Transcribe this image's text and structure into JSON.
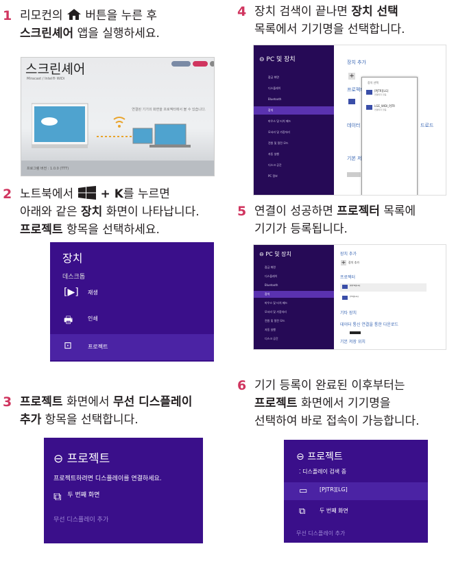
{
  "steps": [
    {
      "num": "1",
      "pre": "리모컨의 ",
      "post": " 버튼을 누른 후",
      "line2_bold": "스크린셰어",
      "line2_rest": " 앱을 실행하세요."
    },
    {
      "num": "2",
      "line1_pre": "노트북에서 ",
      "line1_bold": " + K",
      "line1_post": "를 누르면",
      "line2": "아래와 같은 ",
      "line2_bold": "장치",
      "line2_post": " 화면이 나타납니다.",
      "line3_bold": "프로젝트",
      "line3_post": " 항목을 선택하세요."
    },
    {
      "num": "3",
      "line1_bold": "프로젝트",
      "line1_mid": " 화면에서 ",
      "line1_bold2": "무선 디스플레이",
      "line2_bold": "추가",
      "line2_post": " 항목을 선택합니다."
    },
    {
      "num": "4",
      "line1_pre": "장치 검색이 끝나면 ",
      "line1_bold": "장치 선택",
      "line2": "목록에서 기기명을 선택합니다."
    },
    {
      "num": "5",
      "line1_pre": "연결이 성공하면 ",
      "line1_bold": "프로젝터",
      "line1_post": " 목록에",
      "line2": "기기가 등록됩니다."
    },
    {
      "num": "6",
      "line1": "기기 등록이 완료된 이후부터는",
      "line2_bold": "프로젝트",
      "line2_post": " 화면에서 기기명을",
      "line3": "선택하여 바로 접속이 가능합니다."
    }
  ],
  "screen1": {
    "title": "스크린셰어",
    "subtitle": "Miracast / Intel® WiDi",
    "message": "연결된 기기의 화면을 프로젝터에서 볼 수 있습니다.",
    "version": "프로그램 버전 : 1.0.0 (TTT)"
  },
  "devices_panel": {
    "title": "장치",
    "section": "데스크톱",
    "items": [
      {
        "icon": "[▶]",
        "label": "재생"
      },
      {
        "icon": "🖶",
        "label": "인쇄"
      },
      {
        "icon": "⊡",
        "label": "프로젝트"
      }
    ]
  },
  "project_panel": {
    "title": "프로젝트",
    "instruction": "프로젝트하려면 디스플레이를 연결하세요.",
    "second_screen": "두 번째 화면",
    "add_wireless": "무선 디스플레이 추가"
  },
  "pc_settings": {
    "title": "PC 및 장치",
    "menu": [
      "잠금 화면",
      "디스플레이",
      "Bluetooth",
      "장치",
      "마우스 및 터치 패드",
      "모서리 및 가장자리",
      "전원 및 절전 모드",
      "자동 실행",
      "디스크 공간",
      "PC 정보"
    ],
    "selected": "장치",
    "add_device": "장치 추가",
    "projector": "프로젝터",
    "data": "데이터",
    "data_tail": "드로드",
    "basic": "기본 저",
    "popup_title": "장치 선택",
    "devices": [
      {
        "name": "[PJTR][LG]",
        "status": "연결되지 않음"
      },
      {
        "name": "LGE_WIDI_PJTR",
        "status": "연결되지 않음"
      }
    ]
  },
  "pc_settings5": {
    "title": "PC 및 장치",
    "add_device": "장치 추가",
    "add_device_btn": "장치 추가",
    "projector": "프로젝터",
    "other_devices": "기타 장치",
    "data_download": "데이터 통신 연결을 통한 다운로드",
    "basic_save": "기본 저장 위치",
    "devices": [
      {
        "name": "[PJTR][LG]"
      },
      {
        "name": "[TV][LG]"
      }
    ]
  },
  "project6": {
    "title": "프로젝트",
    "searching": "디스플레이 검색 중",
    "device": "[PJTR][LG]",
    "second_screen": "두 번째 화면",
    "add_wireless": "무선 디스플레이 추가"
  }
}
